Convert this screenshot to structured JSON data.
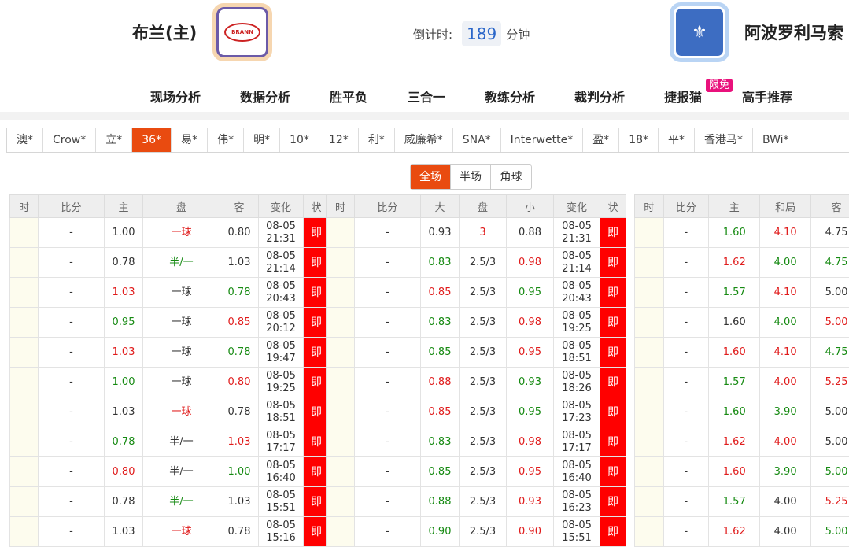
{
  "header": {
    "home_team": "布兰(主)",
    "away_team": "阿波罗利马索",
    "home_logo_text": "BRANN",
    "countdown_label": "倒计时:",
    "countdown_value": "189",
    "countdown_unit": "分钟"
  },
  "nav": [
    "现场分析",
    "数据分析",
    "胜平负",
    "三合一",
    "教练分析",
    "裁判分析",
    "捷报猫",
    "高手推荐"
  ],
  "nav_badge": "限免",
  "companies": [
    "澳*",
    "Crow*",
    "立*",
    "36*",
    "易*",
    "伟*",
    "明*",
    "10*",
    "12*",
    "利*",
    "威廉希*",
    "SNA*",
    "Interwette*",
    "盈*",
    "18*",
    "平*",
    "香港马*",
    "BWi*"
  ],
  "active_company": "36*",
  "periods": [
    "全场",
    "半场",
    "角球"
  ],
  "active_period": "全场",
  "asian": {
    "headers": [
      "时",
      "比分",
      "主",
      "盘",
      "客",
      "变化",
      "状"
    ],
    "rows": [
      {
        "score": "-",
        "home": "1.00",
        "line": "一球",
        "away": "0.80",
        "date": "08-05",
        "time": "21:31",
        "st": "即",
        "hc": "",
        "lc": "up",
        "ac": ""
      },
      {
        "score": "-",
        "home": "0.78",
        "line": "半/一",
        "away": "1.03",
        "date": "08-05",
        "time": "21:14",
        "st": "即",
        "hc": "",
        "lc": "down",
        "ac": ""
      },
      {
        "score": "-",
        "home": "1.03",
        "line": "一球",
        "away": "0.78",
        "date": "08-05",
        "time": "20:43",
        "st": "即",
        "hc": "up",
        "lc": "",
        "ac": "down"
      },
      {
        "score": "-",
        "home": "0.95",
        "line": "一球",
        "away": "0.85",
        "date": "08-05",
        "time": "20:12",
        "st": "即",
        "hc": "down",
        "lc": "",
        "ac": "up"
      },
      {
        "score": "-",
        "home": "1.03",
        "line": "一球",
        "away": "0.78",
        "date": "08-05",
        "time": "19:47",
        "st": "即",
        "hc": "up",
        "lc": "",
        "ac": "down"
      },
      {
        "score": "-",
        "home": "1.00",
        "line": "一球",
        "away": "0.80",
        "date": "08-05",
        "time": "19:25",
        "st": "即",
        "hc": "down",
        "lc": "",
        "ac": "up"
      },
      {
        "score": "-",
        "home": "1.03",
        "line": "一球",
        "away": "0.78",
        "date": "08-05",
        "time": "18:51",
        "st": "即",
        "hc": "",
        "lc": "up",
        "ac": ""
      },
      {
        "score": "-",
        "home": "0.78",
        "line": "半/一",
        "away": "1.03",
        "date": "08-05",
        "time": "17:17",
        "st": "即",
        "hc": "down",
        "lc": "",
        "ac": "up"
      },
      {
        "score": "-",
        "home": "0.80",
        "line": "半/一",
        "away": "1.00",
        "date": "08-05",
        "time": "16:40",
        "st": "即",
        "hc": "up",
        "lc": "",
        "ac": "down"
      },
      {
        "score": "-",
        "home": "0.78",
        "line": "半/一",
        "away": "1.03",
        "date": "08-05",
        "time": "15:51",
        "st": "即",
        "hc": "",
        "lc": "down",
        "ac": ""
      },
      {
        "score": "-",
        "home": "1.03",
        "line": "一球",
        "away": "0.78",
        "date": "08-05",
        "time": "15:16",
        "st": "即",
        "hc": "",
        "lc": "up",
        "ac": ""
      }
    ]
  },
  "overunder": {
    "headers": [
      "时",
      "比分",
      "大",
      "盘",
      "小",
      "变化",
      "状"
    ],
    "rows": [
      {
        "score": "-",
        "over": "0.93",
        "line": "3",
        "under": "0.88",
        "date": "08-05",
        "time": "21:31",
        "st": "即",
        "oc": "",
        "lc": "up",
        "uc": ""
      },
      {
        "score": "-",
        "over": "0.83",
        "line": "2.5/3",
        "under": "0.98",
        "date": "08-05",
        "time": "21:14",
        "st": "即",
        "oc": "down",
        "lc": "",
        "uc": "up"
      },
      {
        "score": "-",
        "over": "0.85",
        "line": "2.5/3",
        "under": "0.95",
        "date": "08-05",
        "time": "20:43",
        "st": "即",
        "oc": "up",
        "lc": "",
        "uc": "down"
      },
      {
        "score": "-",
        "over": "0.83",
        "line": "2.5/3",
        "under": "0.98",
        "date": "08-05",
        "time": "19:25",
        "st": "即",
        "oc": "down",
        "lc": "",
        "uc": "up"
      },
      {
        "score": "-",
        "over": "0.85",
        "line": "2.5/3",
        "under": "0.95",
        "date": "08-05",
        "time": "18:51",
        "st": "即",
        "oc": "down",
        "lc": "",
        "uc": "up"
      },
      {
        "score": "-",
        "over": "0.88",
        "line": "2.5/3",
        "under": "0.93",
        "date": "08-05",
        "time": "18:26",
        "st": "即",
        "oc": "up",
        "lc": "",
        "uc": "down"
      },
      {
        "score": "-",
        "over": "0.85",
        "line": "2.5/3",
        "under": "0.95",
        "date": "08-05",
        "time": "17:23",
        "st": "即",
        "oc": "up",
        "lc": "",
        "uc": "down"
      },
      {
        "score": "-",
        "over": "0.83",
        "line": "2.5/3",
        "under": "0.98",
        "date": "08-05",
        "time": "17:17",
        "st": "即",
        "oc": "down",
        "lc": "",
        "uc": "up"
      },
      {
        "score": "-",
        "over": "0.85",
        "line": "2.5/3",
        "under": "0.95",
        "date": "08-05",
        "time": "16:40",
        "st": "即",
        "oc": "down",
        "lc": "",
        "uc": "up"
      },
      {
        "score": "-",
        "over": "0.88",
        "line": "2.5/3",
        "under": "0.93",
        "date": "08-05",
        "time": "16:23",
        "st": "即",
        "oc": "down",
        "lc": "",
        "uc": "up"
      },
      {
        "score": "-",
        "over": "0.90",
        "line": "2.5/3",
        "under": "0.90",
        "date": "08-05",
        "time": "15:51",
        "st": "即",
        "oc": "down",
        "lc": "",
        "uc": "up"
      }
    ]
  },
  "europe": {
    "headers": [
      "时",
      "比分",
      "主",
      "和局",
      "客"
    ],
    "rows": [
      {
        "score": "-",
        "home": "1.60",
        "draw": "4.10",
        "away": "4.75",
        "hc": "down",
        "dc": "up",
        "ac": ""
      },
      {
        "score": "-",
        "home": "1.62",
        "draw": "4.00",
        "away": "4.75",
        "hc": "up",
        "dc": "down",
        "ac": "down"
      },
      {
        "score": "-",
        "home": "1.57",
        "draw": "4.10",
        "away": "5.00",
        "hc": "down",
        "dc": "up",
        "ac": ""
      },
      {
        "score": "-",
        "home": "1.60",
        "draw": "4.00",
        "away": "5.00",
        "hc": "",
        "dc": "down",
        "ac": "up"
      },
      {
        "score": "-",
        "home": "1.60",
        "draw": "4.10",
        "away": "4.75",
        "hc": "up",
        "dc": "up",
        "ac": "down"
      },
      {
        "score": "-",
        "home": "1.57",
        "draw": "4.00",
        "away": "5.25",
        "hc": "down",
        "dc": "up",
        "ac": "up"
      },
      {
        "score": "-",
        "home": "1.60",
        "draw": "3.90",
        "away": "5.00",
        "hc": "down",
        "dc": "down",
        "ac": ""
      },
      {
        "score": "-",
        "home": "1.62",
        "draw": "4.00",
        "away": "5.00",
        "hc": "up",
        "dc": "up",
        "ac": ""
      },
      {
        "score": "-",
        "home": "1.60",
        "draw": "3.90",
        "away": "5.00",
        "hc": "up",
        "dc": "down",
        "ac": "down"
      },
      {
        "score": "-",
        "home": "1.57",
        "draw": "4.00",
        "away": "5.25",
        "hc": "down",
        "dc": "",
        "ac": "up"
      },
      {
        "score": "-",
        "home": "1.62",
        "draw": "4.00",
        "away": "5.00",
        "hc": "up",
        "dc": "",
        "ac": "down"
      }
    ]
  },
  "colors": {
    "accent": "#e94b10",
    "status_bg": "#ff0000",
    "up": "#e01c1c",
    "down": "#168a12"
  }
}
